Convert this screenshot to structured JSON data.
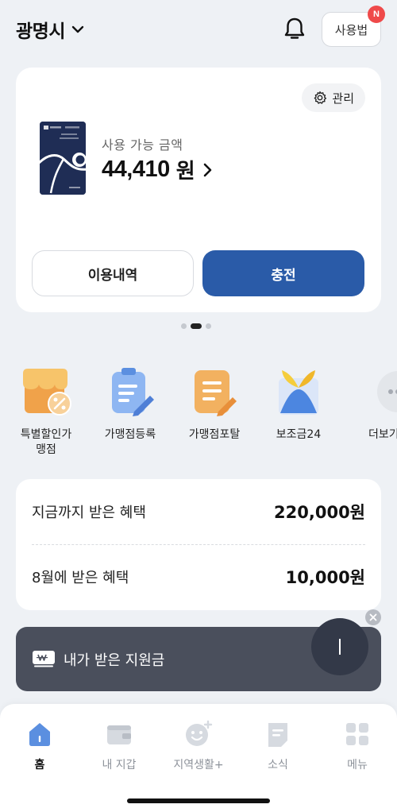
{
  "header": {
    "city": "광명시",
    "howto_label": "사용법",
    "badge": "N"
  },
  "card": {
    "manage_label": "관리",
    "balance_label": "사용 가능 금액",
    "balance_amount": "44,410",
    "balance_unit": "원",
    "history_label": "이용내역",
    "charge_label": "충전",
    "pager": {
      "count": 3,
      "active": 2
    }
  },
  "shortcuts": [
    {
      "label": "특별할인가\n맹점",
      "icon": "store-discount-icon"
    },
    {
      "label": "가맹점등록",
      "icon": "clipboard-pen-icon"
    },
    {
      "label": "가맹점포탈",
      "icon": "document-pen-icon"
    },
    {
      "label": "보조금24",
      "icon": "gift-box-icon"
    },
    {
      "label": "더보기",
      "icon": "more-icon"
    }
  ],
  "benefits": {
    "total_label": "지금까지 받은 혜택",
    "total_value": "220,000원",
    "month_label": "8월에 받은 혜택",
    "month_value": "10,000원"
  },
  "banner": {
    "text": "내가 받은 지원금"
  },
  "tabs": [
    {
      "label": "홈",
      "icon": "home-icon",
      "active": true
    },
    {
      "label": "내 지갑",
      "icon": "wallet-icon",
      "active": false
    },
    {
      "label": "지역생활+",
      "icon": "smile-plus-icon",
      "active": false
    },
    {
      "label": "소식",
      "icon": "news-icon",
      "active": false
    },
    {
      "label": "메뉴",
      "icon": "grid-menu-icon",
      "active": false
    }
  ],
  "colors": {
    "primary": "#2a5ba8",
    "background": "#eef1f5",
    "badge": "#ef4a4a",
    "banner": "#4a4f5c"
  }
}
